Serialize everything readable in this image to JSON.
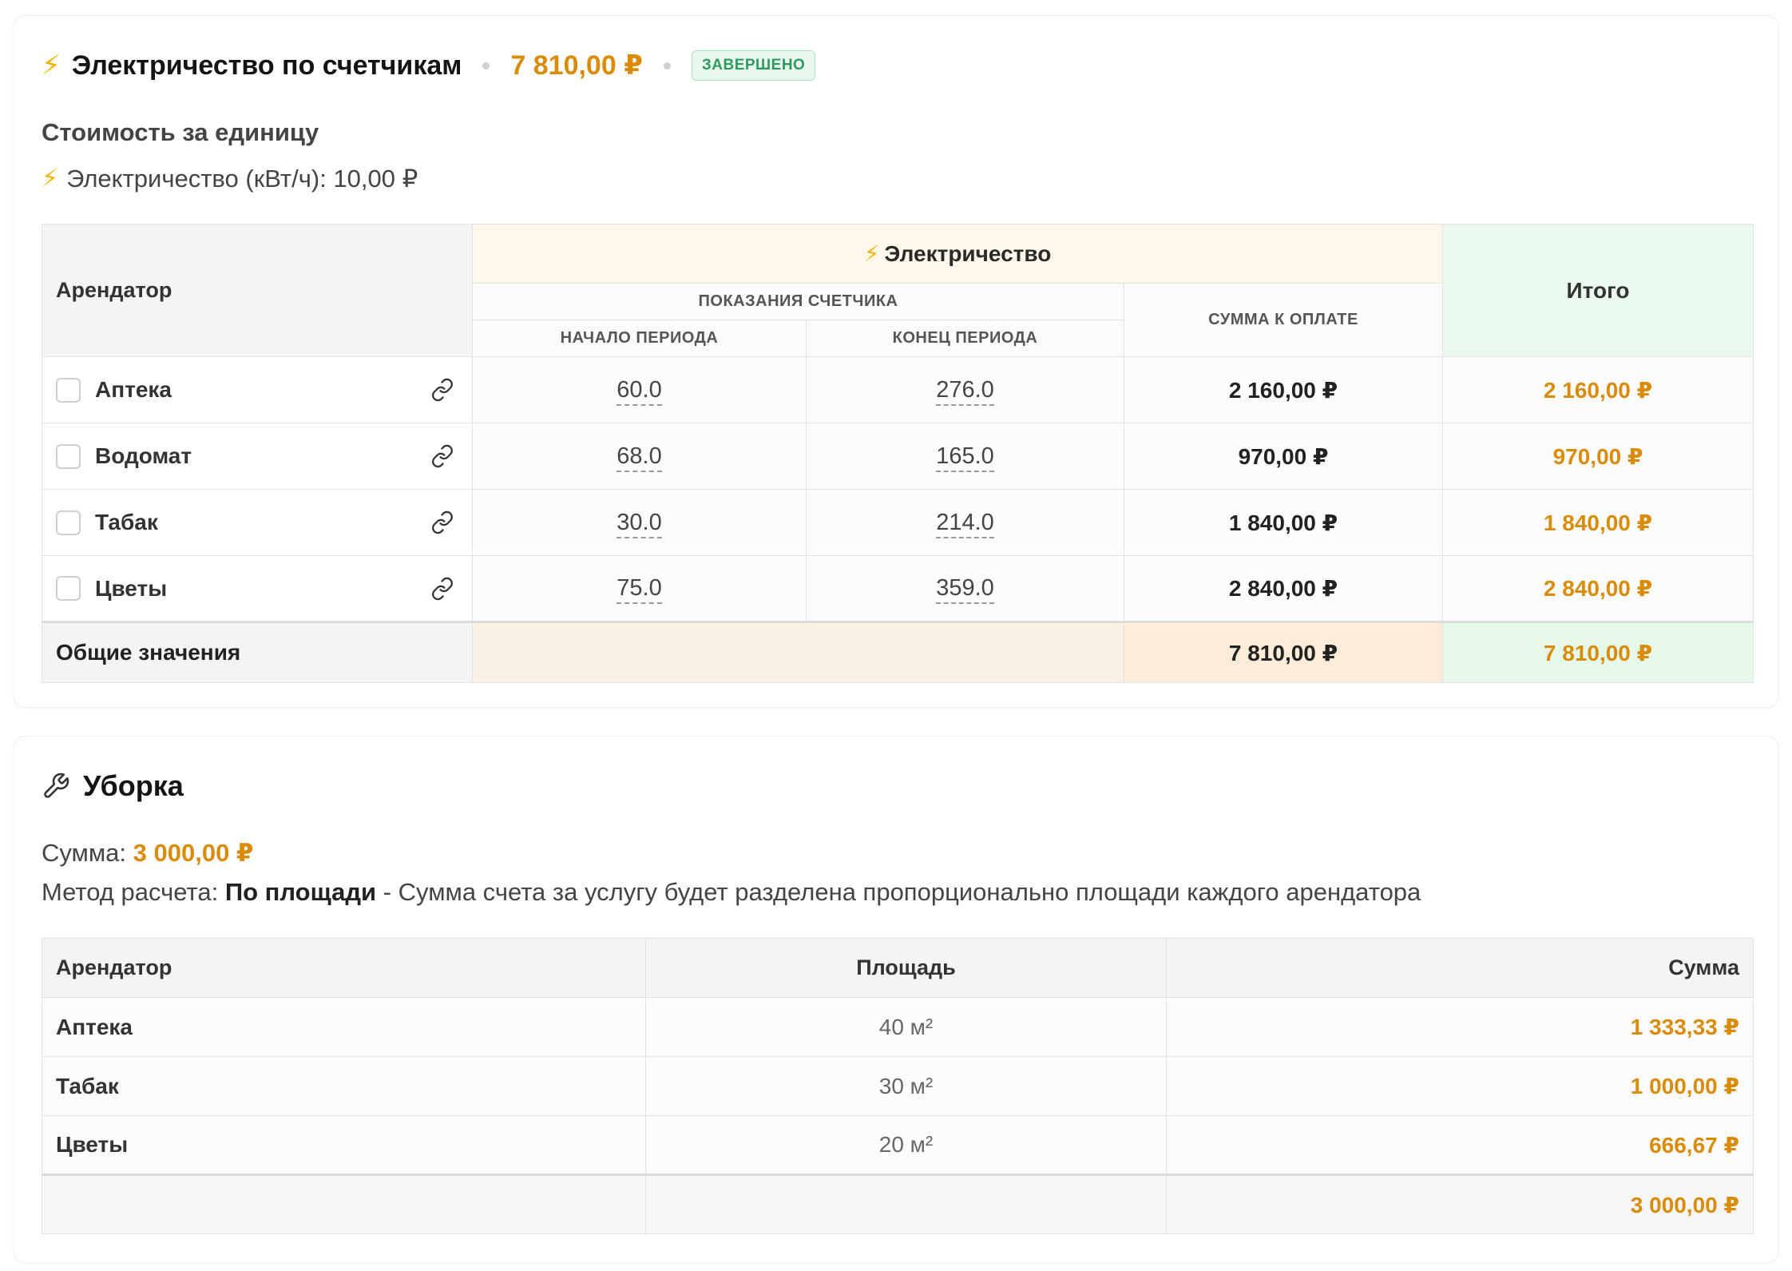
{
  "electricity": {
    "title": "Электричество по счетчикам",
    "total": "7 810,00 ₽",
    "status": "ЗАВЕРШЕНО",
    "unit_cost_title": "Стоимость за единицу",
    "unit_cost_line": "Электричество (кВт/ч): 10,00 ₽",
    "table": {
      "col_tenant": "Арендатор",
      "col_group": "Электричество",
      "col_readings": "ПОКАЗАНИЯ СЧЕТЧИКА",
      "col_start": "НАЧАЛО ПЕРИОДА",
      "col_end": "КОНЕЦ ПЕРИОДА",
      "col_due": "СУММА К ОПЛАТЕ",
      "col_total": "Итого",
      "rows": [
        {
          "tenant": "Аптека",
          "start": "60.0",
          "end": "276.0",
          "due": "2 160,00 ₽",
          "total": "2 160,00 ₽"
        },
        {
          "tenant": "Водомат",
          "start": "68.0",
          "end": "165.0",
          "due": "970,00 ₽",
          "total": "970,00 ₽"
        },
        {
          "tenant": "Табак",
          "start": "30.0",
          "end": "214.0",
          "due": "1 840,00 ₽",
          "total": "1 840,00 ₽"
        },
        {
          "tenant": "Цветы",
          "start": "75.0",
          "end": "359.0",
          "due": "2 840,00 ₽",
          "total": "2 840,00 ₽"
        }
      ],
      "summary_label": "Общие значения",
      "summary_due": "7 810,00 ₽",
      "summary_total": "7 810,00 ₽"
    }
  },
  "cleaning": {
    "title": "Уборка",
    "sum_label": "Сумма: ",
    "sum_value": "3 000,00 ₽",
    "method_label": "Метод расчета: ",
    "method_value": "По площади",
    "method_desc": " - Сумма счета за услугу будет разделена пропорционально площади каждого арендатора",
    "table": {
      "col_tenant": "Арендатор",
      "col_area": "Площадь",
      "col_sum": "Сумма",
      "rows": [
        {
          "tenant": "Аптека",
          "area": "40 м²",
          "sum": "1 333,33 ₽"
        },
        {
          "tenant": "Табак",
          "area": "30 м²",
          "sum": "1 000,00 ₽"
        },
        {
          "tenant": "Цветы",
          "area": "20 м²",
          "sum": "666,67 ₽"
        }
      ],
      "footer_total": "3 000,00 ₽"
    }
  },
  "colors": {
    "accent_amount": "#d98b0a",
    "status_green": "#2f9a5b",
    "bolt": "#f2b600"
  }
}
